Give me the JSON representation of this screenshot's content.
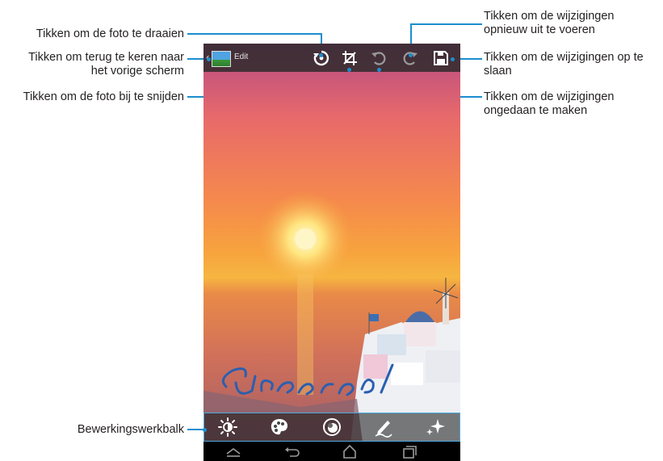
{
  "callouts": {
    "rotate": "Tikken om de foto te draaien",
    "back_line1": "Tikken om terug te keren naar",
    "back_line2": "het vorige scherm",
    "crop": "Tikken om de foto bij te snijden",
    "redo_line1": "Tikken om de wijzigingen",
    "redo_line2": "opnieuw uit te voeren",
    "save_line1": "Tikken om de wijzigingen op te",
    "save_line2": "slaan",
    "undo_line1": "Tikken om de wijzigingen",
    "undo_line2": "ongedaan te maken",
    "toolbar": "Bewerkingswerkbalk"
  },
  "app": {
    "back_glyph": "‹",
    "title": "Edit",
    "action_icons": [
      "rotate-icon",
      "crop-icon",
      "undo-icon",
      "redo-icon",
      "save-icon"
    ],
    "tool_icons": [
      "brightness-icon",
      "palette-icon",
      "effect-icon",
      "draw-icon",
      "sparkle-icon"
    ],
    "nav_icons": [
      "nav-up-icon",
      "nav-back-icon",
      "nav-home-icon",
      "nav-recent-icon"
    ]
  },
  "photo": {
    "handwriting": "Greece!"
  },
  "colors": {
    "accent": "#1b8ecf",
    "text": "#231f20"
  }
}
